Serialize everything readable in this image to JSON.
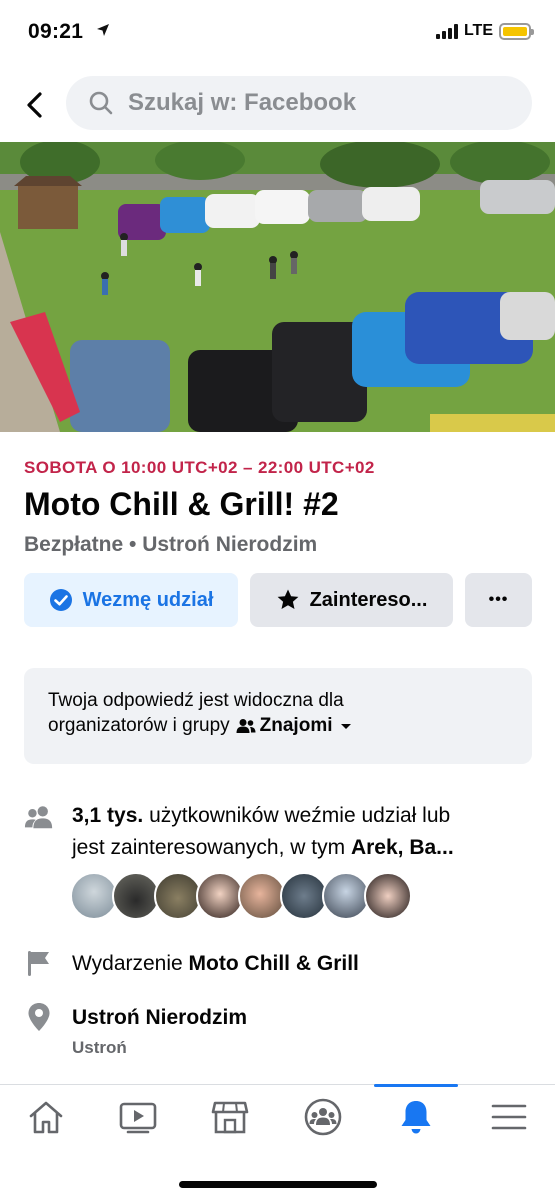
{
  "status_bar": {
    "time": "09:21",
    "network": "LTE"
  },
  "header": {
    "search_placeholder": "Szukaj w: Facebook"
  },
  "event": {
    "date": "SOBOTA O 10:00 UTC+02 – 22:00 UTC+02",
    "title": "Moto Chill & Grill! #2",
    "subtitle": "Bezpłatne • Ustroń Nierodzim",
    "going_label": "Wezmę udział",
    "interested_label": "Zaintereso...",
    "more_label": "•••"
  },
  "notice": {
    "line1": "Twoja odpowiedź jest widoczna dla",
    "line2_prefix": "organizatorów i grupy",
    "audience": "Znajomi"
  },
  "attendance": {
    "count": "3,1 tys.",
    "text1": "użytkowników weźmie udział lub",
    "text2": "jest zainteresowanych, w tym",
    "names": "Arek, Ba..."
  },
  "details": {
    "event_prefix": "Wydarzenie",
    "event_name": "Moto Chill & Grill",
    "location": "Ustroń Nierodzim",
    "location_sub": "Ustroń"
  },
  "colors": {
    "accent": "#1877f2",
    "date_red": "#c2244a",
    "battery": "#f5c400"
  },
  "icons": [
    "location-arrow-icon",
    "back-arrow-icon",
    "search-icon",
    "check-circle-icon",
    "star-icon",
    "more-dots-icon",
    "friends-icon",
    "people-icon",
    "flag-icon",
    "map-pin-icon",
    "home-icon",
    "video-icon",
    "marketplace-icon",
    "groups-icon",
    "bell-icon",
    "menu-icon"
  ]
}
